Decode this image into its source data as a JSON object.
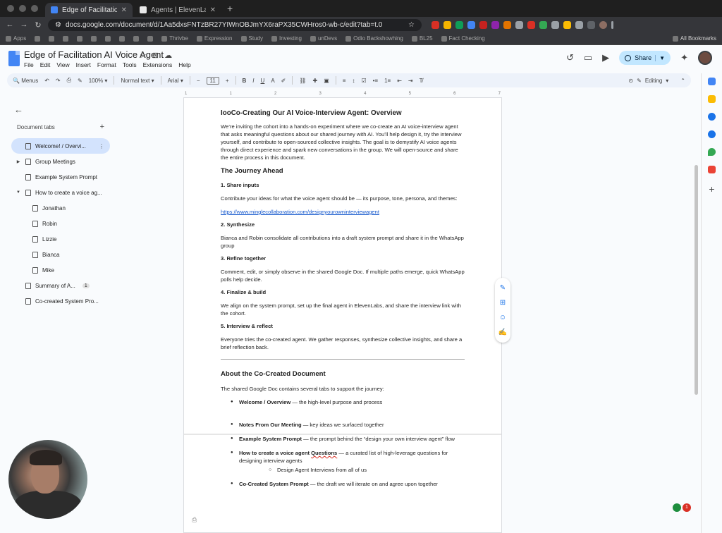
{
  "browser": {
    "tabs": [
      {
        "title": "Edge of Facilitation AI Voice A",
        "active": true,
        "favicon_color": "#4285f4"
      },
      {
        "title": "Agents | ElevenLabs",
        "active": false,
        "favicon_color": "#e8e8e8"
      }
    ],
    "new_tab": "+",
    "url": "docs.google.com/document/d/1Aa5dxsFNTzBR27YIWnOBJmYX6raPX35CWHros0-wb-c/edit?tab=t.0",
    "bookmarks": [
      "Apps",
      "Thrivbe",
      "Expression",
      "Study",
      "Investing",
      "unDevs",
      "Odio Backshowhing",
      "BL25",
      "Fact Checking"
    ],
    "all_bookmarks": "All Bookmarks"
  },
  "docs": {
    "title": "Edge of Facilitation AI Voice Agent",
    "menus": [
      "File",
      "Edit",
      "View",
      "Insert",
      "Format",
      "Tools",
      "Extensions",
      "Help"
    ],
    "share_label": "Share",
    "toolbar": {
      "menus_label": "Menus",
      "zoom": "100%",
      "style": "Normal text",
      "font": "Arial",
      "font_size": "11",
      "mode": "Editing"
    },
    "ruler": [
      "1",
      "1",
      "2",
      "3",
      "4",
      "5",
      "6",
      "7"
    ]
  },
  "sidebar": {
    "heading": "Document tabs",
    "tabs": [
      {
        "label": "Welcome! / Overvi...",
        "active": true,
        "chevron": "",
        "child": false,
        "badge": ""
      },
      {
        "label": "Group Meetings",
        "active": false,
        "chevron": "▶",
        "child": false,
        "badge": ""
      },
      {
        "label": "Example System Prompt",
        "active": false,
        "chevron": "",
        "child": false,
        "badge": ""
      },
      {
        "label": "How to create a voice ag...",
        "active": false,
        "chevron": "▼",
        "child": false,
        "badge": ""
      },
      {
        "label": "Jonathan",
        "active": false,
        "chevron": "",
        "child": true,
        "badge": ""
      },
      {
        "label": "Robin",
        "active": false,
        "chevron": "",
        "child": true,
        "badge": ""
      },
      {
        "label": "Lizzie",
        "active": false,
        "chevron": "",
        "child": true,
        "badge": ""
      },
      {
        "label": "Bianca",
        "active": false,
        "chevron": "",
        "child": true,
        "badge": ""
      },
      {
        "label": "Mike",
        "active": false,
        "chevron": "",
        "child": true,
        "badge": ""
      },
      {
        "label": "Summary of A...",
        "active": false,
        "chevron": "",
        "child": false,
        "badge": "1"
      },
      {
        "label": "Co-created System Pro...",
        "active": false,
        "chevron": "",
        "child": false,
        "badge": ""
      }
    ]
  },
  "document": {
    "title": "IooCo-Creating Our AI Voice-Interview Agent: Overview",
    "intro": "We’re inviting the cohort into a hands-on experiment where we co-create an AI voice-interview agent that asks meaningful questions about our shared journey with AI. You’ll help design it, try the interview yourself, and contribute to open-sourced collective insights. The goal is to demystify AI voice agents through direct experience and spark new conversations in the group. We will open-source and share the entire process in this document.",
    "journey_heading": "The Journey Ahead",
    "steps": [
      {
        "title": "1. Share inputs",
        "body": "Contribute your ideas for what the voice agent should be — its purpose, tone, persona, and themes:",
        "link": "https://www.minglecollaboration.com/designyourowninterviewagent"
      },
      {
        "title": "2. Synthesize",
        "body": "Bianca and Robin consolidate all contributions into a draft system prompt and share it in the WhatsApp group",
        "link": ""
      },
      {
        "title": "3. Refine together",
        "body": "Comment, edit, or simply observe in the shared Google Doc. If multiple paths emerge, quick WhatsApp polls help decide.",
        "link": ""
      },
      {
        "title": "4. Finalize & build",
        "body": "We align on the system prompt, set up the final agent in ElevenLabs, and share the interview link with the cohort.",
        "link": ""
      },
      {
        "title": "5. Interview & reflect",
        "body": "Everyone tries the co-created agent. We gather responses, synthesize collective insights, and share a brief reflection back.",
        "link": ""
      }
    ],
    "about_heading": "About the Co-Created Document",
    "about_intro": "The shared Google Doc contains several tabs to support the journey:",
    "bullets": [
      {
        "bold": "Welcome / Overview",
        "rest": " — the high-level purpose and process"
      },
      {
        "bold": "Notes From Our Meeting",
        "rest": " — key ideas we surfaced together"
      },
      {
        "bold": "Example System Prompt",
        "rest": " — the prompt behind the “design your own interview agent” flow"
      },
      {
        "bold": "How to create a voice agent ",
        "bold_underlined": "Questions",
        "rest": " — a curated list of high-leverage questions for designing interview agents",
        "sub": "Design Agent Interviews from all of us"
      },
      {
        "bold": "Co-Created System Prompt",
        "rest": " — the draft we will iterate on and agree upon together"
      }
    ]
  },
  "notification_count": "1"
}
